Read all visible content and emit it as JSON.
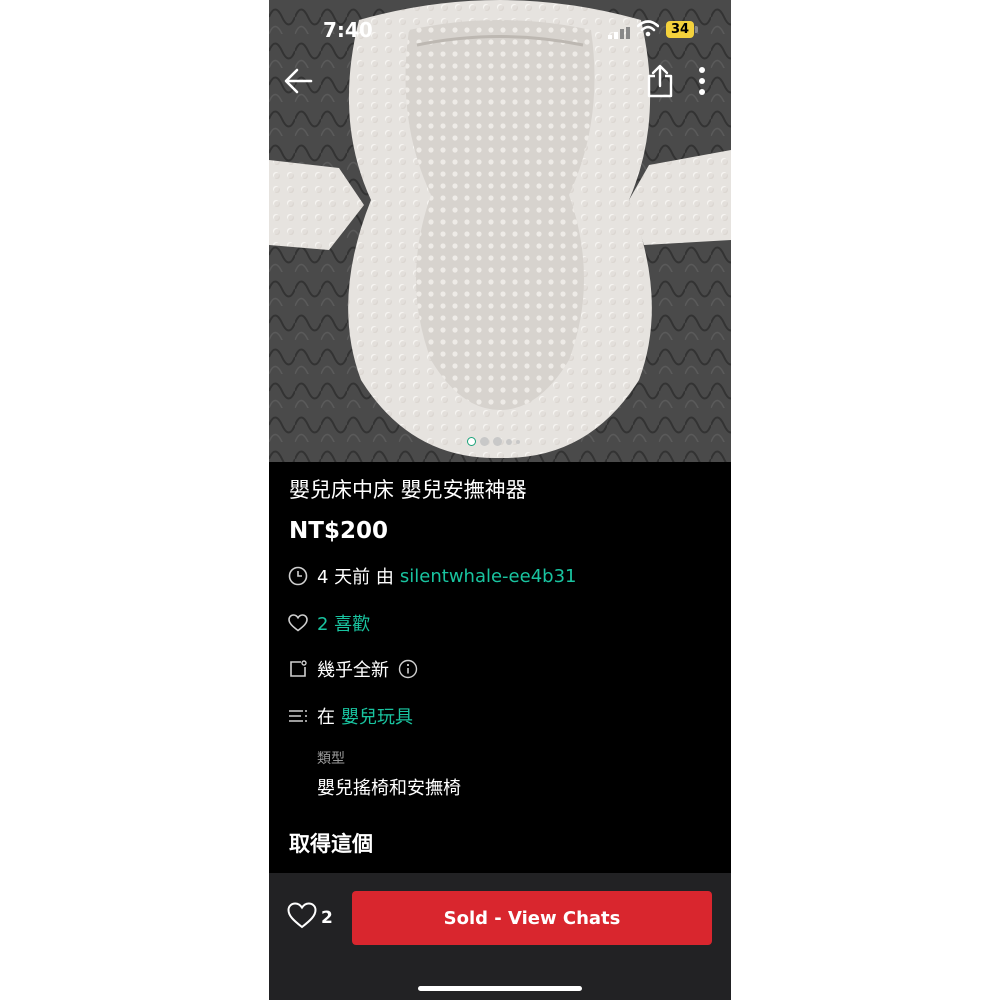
{
  "status_bar": {
    "time": "7:40",
    "battery": "34"
  },
  "listing": {
    "title": "嬰兒床中床 嬰兒安撫神器",
    "price": "NT$200",
    "posted": {
      "time_ago": "4 天前 由",
      "seller": "silentwhale-ee4b31"
    },
    "likes": "2 喜歡",
    "condition": "幾乎全新",
    "category": {
      "prefix": "在",
      "name": "嬰兒玩具"
    },
    "type": {
      "label": "類型",
      "value": "嬰兒搖椅和安撫椅"
    }
  },
  "section_heading": "取得這個",
  "bottom_bar": {
    "like_count": "2",
    "action_label": "Sold - View Chats"
  },
  "image_carousel": {
    "total_dots": 5,
    "active_index": 0
  },
  "colors": {
    "accent": "#19c4a0",
    "action": "#d9262e",
    "background": "#000000",
    "bar": "#222224",
    "battery": "#f4d23c"
  },
  "icons": [
    "back-arrow-icon",
    "share-icon",
    "more-vertical-icon",
    "clock-icon",
    "heart-icon",
    "tag-icon",
    "info-icon",
    "list-icon"
  ]
}
